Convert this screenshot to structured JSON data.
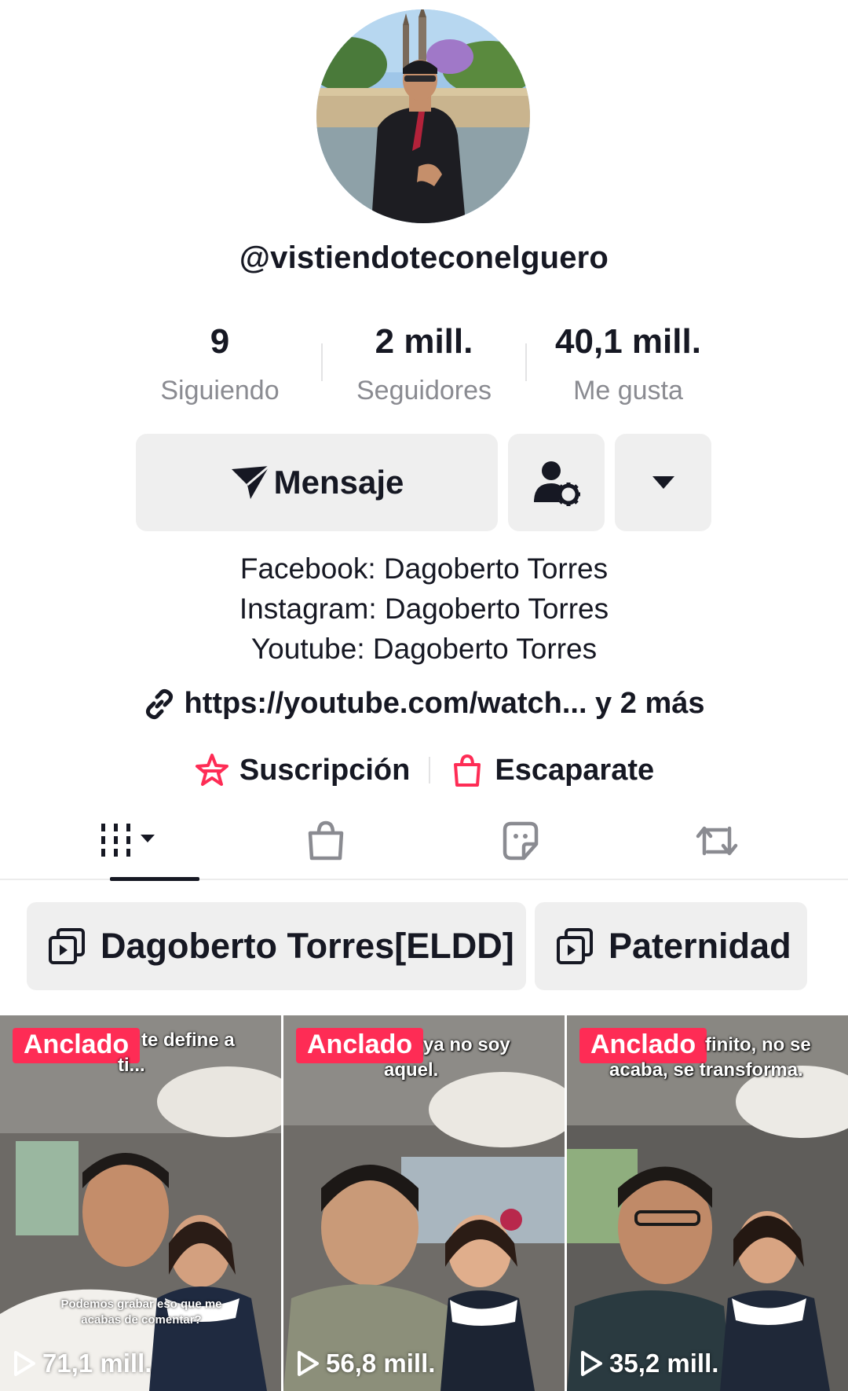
{
  "profile": {
    "username": "@vistiendoteconelguero",
    "stats": [
      {
        "value": "9",
        "label": "Siguiendo"
      },
      {
        "value": "2 mill.",
        "label": "Seguidores"
      },
      {
        "value": "40,1 mill.",
        "label": "Me gusta"
      }
    ],
    "message_label": "Mensaje",
    "bio": [
      "Facebook: Dagoberto Torres",
      "Instagram: Dagoberto Torres",
      "Youtube: Dagoberto Torres"
    ],
    "link_text": "https://youtube.com/watch... y 2 más",
    "chips": {
      "subscription": "Suscripción",
      "showcase": "Escaparate"
    }
  },
  "tabs": [
    {
      "icon": "videos-grid-icon",
      "active": true
    },
    {
      "icon": "shopping-bag-icon",
      "active": false
    },
    {
      "icon": "sticker-icon",
      "active": false
    },
    {
      "icon": "repost-icon",
      "active": false
    }
  ],
  "playlists": [
    {
      "label": "Dagoberto Torres[ELDD]"
    },
    {
      "label": "Paternidad"
    }
  ],
  "videos": [
    {
      "pinned": "Anclado",
      "caption_top": "te define a",
      "caption_bottom": "ti...",
      "subtitle": "Podemos grabar eso que me acabas de comentar?",
      "views": "71,1 mill."
    },
    {
      "pinned": "Anclado",
      "caption_top": "ya no soy",
      "caption_bottom": "aquel.",
      "subtitle": "",
      "views": "56,8 mill."
    },
    {
      "pinned": "Anclado",
      "caption_top": "finito, no se",
      "caption_bottom": "acaba, se transforma.",
      "subtitle": "",
      "views": "35,2 mill."
    }
  ],
  "colors": {
    "accent": "#fe2c55",
    "text": "#161823",
    "muted": "#8a8b91",
    "button_bg": "#efefef"
  }
}
